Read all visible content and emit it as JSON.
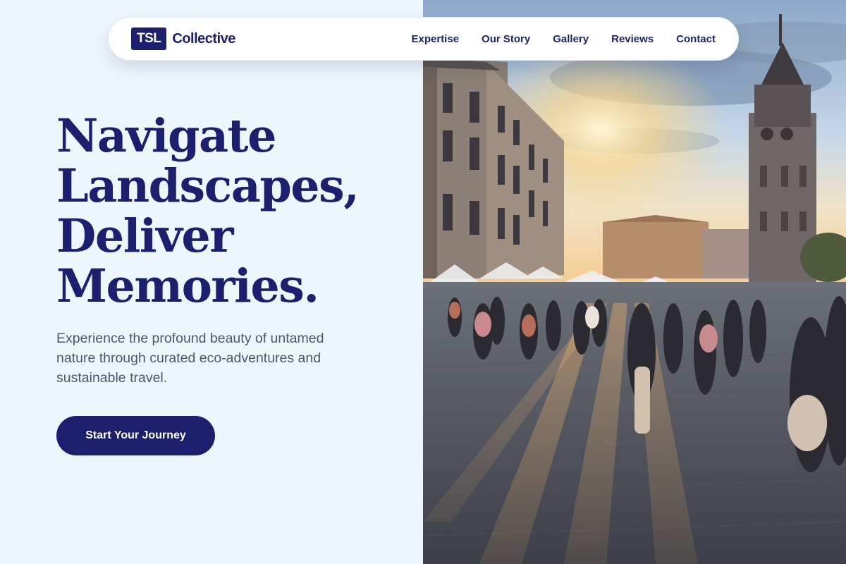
{
  "brand": {
    "mark": "TSL",
    "name": "Collective"
  },
  "nav": {
    "links": [
      "Expertise",
      "Our Story",
      "Gallery",
      "Reviews",
      "Contact"
    ]
  },
  "hero": {
    "title_lines": [
      "Navigate",
      "Landscapes,",
      "Deliver",
      "Memories."
    ],
    "subtitle": "Experience the profound beauty of untamed nature through curated eco-adventures and sustainable travel.",
    "cta_label": "Start Your Journey"
  },
  "colors": {
    "primary": "#1b1f6e",
    "background": "#eef6fd",
    "body_text": "#4a5670"
  },
  "icons": {
    "hero_image": "city-square-sunset-photo"
  }
}
